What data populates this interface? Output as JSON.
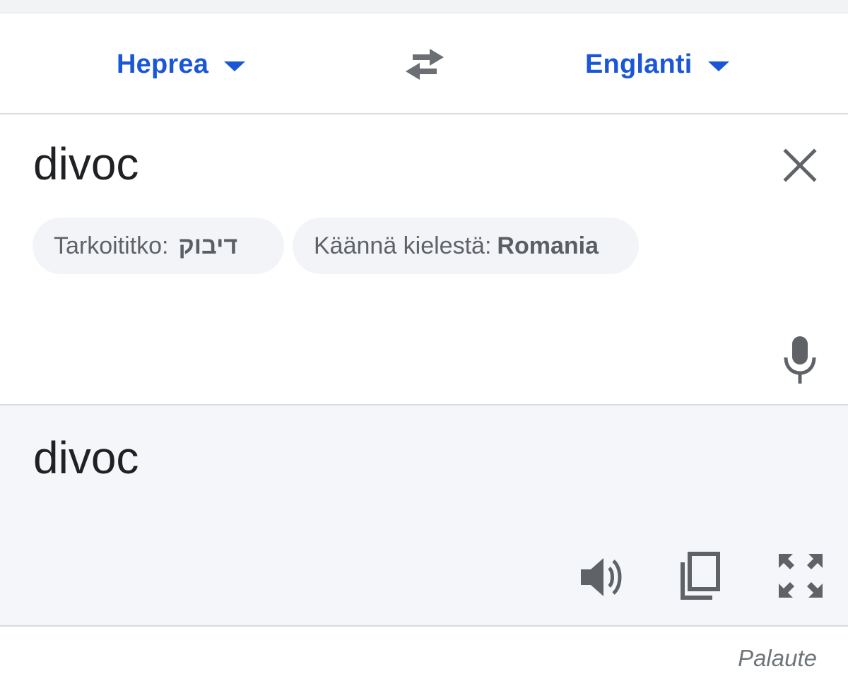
{
  "language_bar": {
    "source_language": "Heprea",
    "target_language": "Englanti",
    "swap_icon": "swap-arrows-icon",
    "accent_color": "#1a56d6"
  },
  "input": {
    "text": "divoc",
    "clear_icon": "close-icon",
    "mic_icon": "microphone-icon",
    "suggestions": [
      {
        "label": "Tarkoititko:",
        "value": "דיבוק"
      },
      {
        "label": "Käännä kielestä:",
        "value": "Romania"
      }
    ]
  },
  "output": {
    "text": "divoc",
    "icons": [
      "speaker-icon",
      "copy-icon",
      "fullscreen-icon"
    ],
    "background": "#f5f6f9"
  },
  "footer": {
    "feedback": "Palaute"
  }
}
